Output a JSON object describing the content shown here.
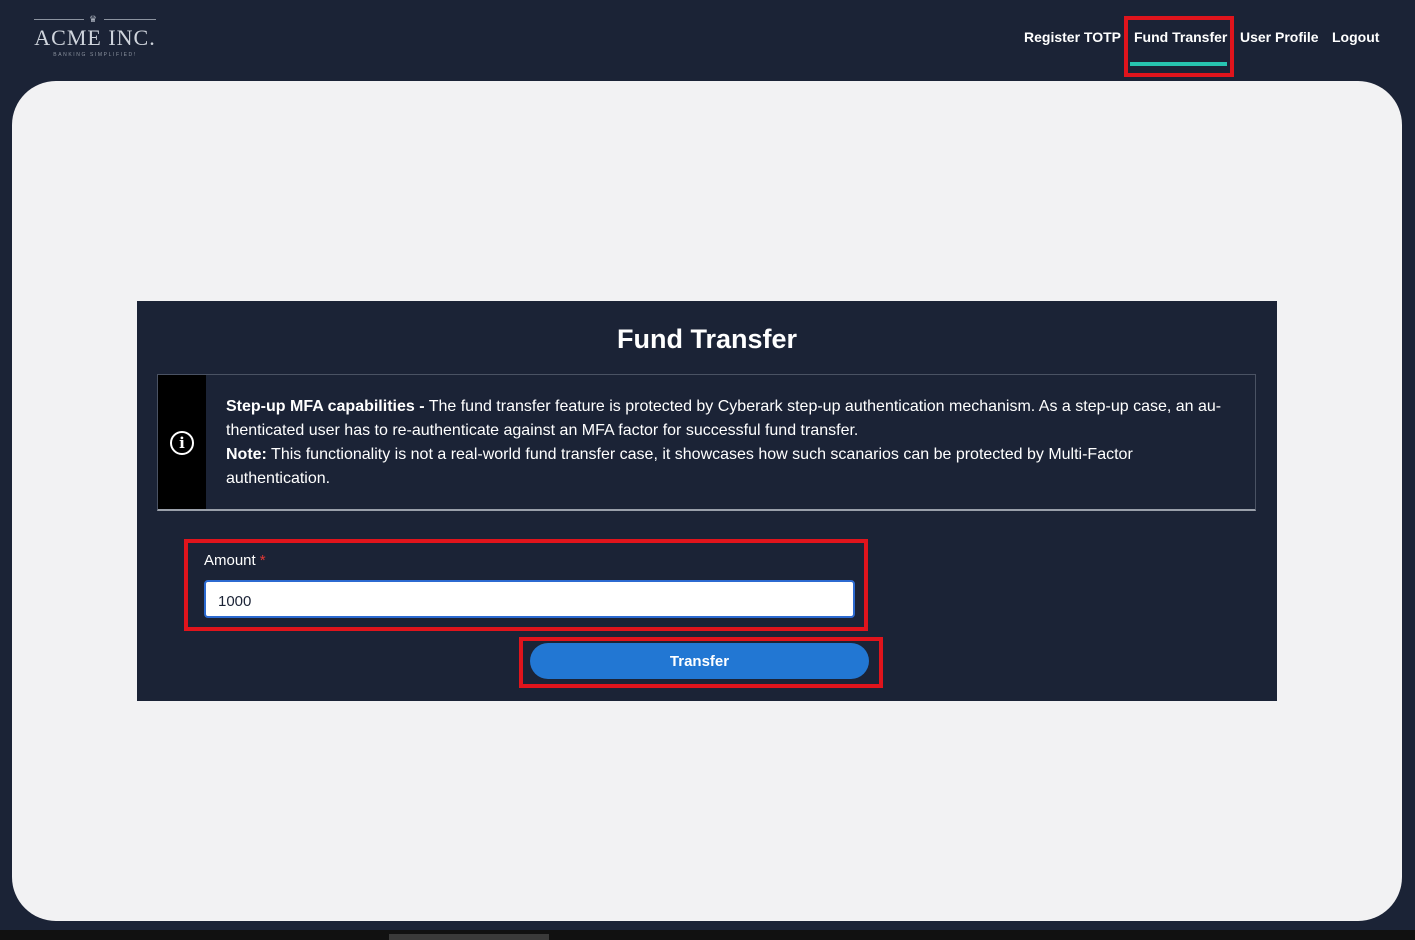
{
  "header": {
    "logo": {
      "name": "ACME INC.",
      "tagline": "BANKING SIMPLIFIED!"
    },
    "nav": [
      {
        "label": "Register TOTP"
      },
      {
        "label": "Fund Transfer",
        "active": true
      },
      {
        "label": "User Profile"
      },
      {
        "label": "Logout"
      }
    ]
  },
  "card": {
    "title": "Fund Transfer",
    "info": {
      "icon": "info-icon",
      "heading": "Step-up MFA capabilities -",
      "text": " The fund transfer feature is protected by Cyberark step-up authentication mechanism. As a step-up case, an au-thenticated user has to re-authenticate against an MFA factor for successful fund transfer.",
      "note_label": "Note:",
      "note_text": " This functionality is not a real-world fund transfer case, it showcases how such scanarios can be protected by Multi-Factor authentication."
    },
    "amount": {
      "label": "Amount",
      "required_mark": "*",
      "value": "1000"
    },
    "transfer_button": "Transfer"
  },
  "colors": {
    "background": "#1b2336",
    "panel": "#f2f2f3",
    "accent_underline": "#27c4b0",
    "button": "#2277d3",
    "highlight": "#e0141c"
  }
}
